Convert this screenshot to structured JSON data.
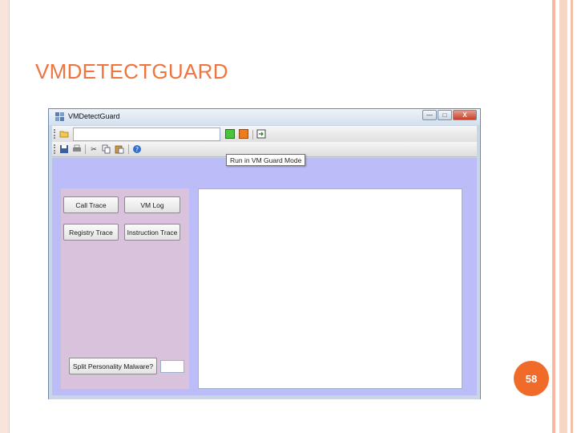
{
  "slide": {
    "title": "VMDETECTGUARD",
    "page_number": "58"
  },
  "window": {
    "title": "VMDetectGuard",
    "controls": {
      "minimize": "—",
      "maximize": "□",
      "close": "X"
    }
  },
  "toolbar1": {
    "path_value": "",
    "tooltip": "Run in VM Guard Mode"
  },
  "panel": {
    "buttons": {
      "call_trace": "Call Trace",
      "vm_log": "VM Log",
      "registry_trace": "Registry Trace",
      "instruction_trace": "Instruction Trace",
      "split_personality": "Split Personality Malware?"
    },
    "small_input_value": ""
  },
  "output": {
    "text": ""
  },
  "colors": {
    "accent": "#f0743d",
    "client_bg": "#bcbcf8",
    "panel_bg": "#d8c2dc"
  }
}
